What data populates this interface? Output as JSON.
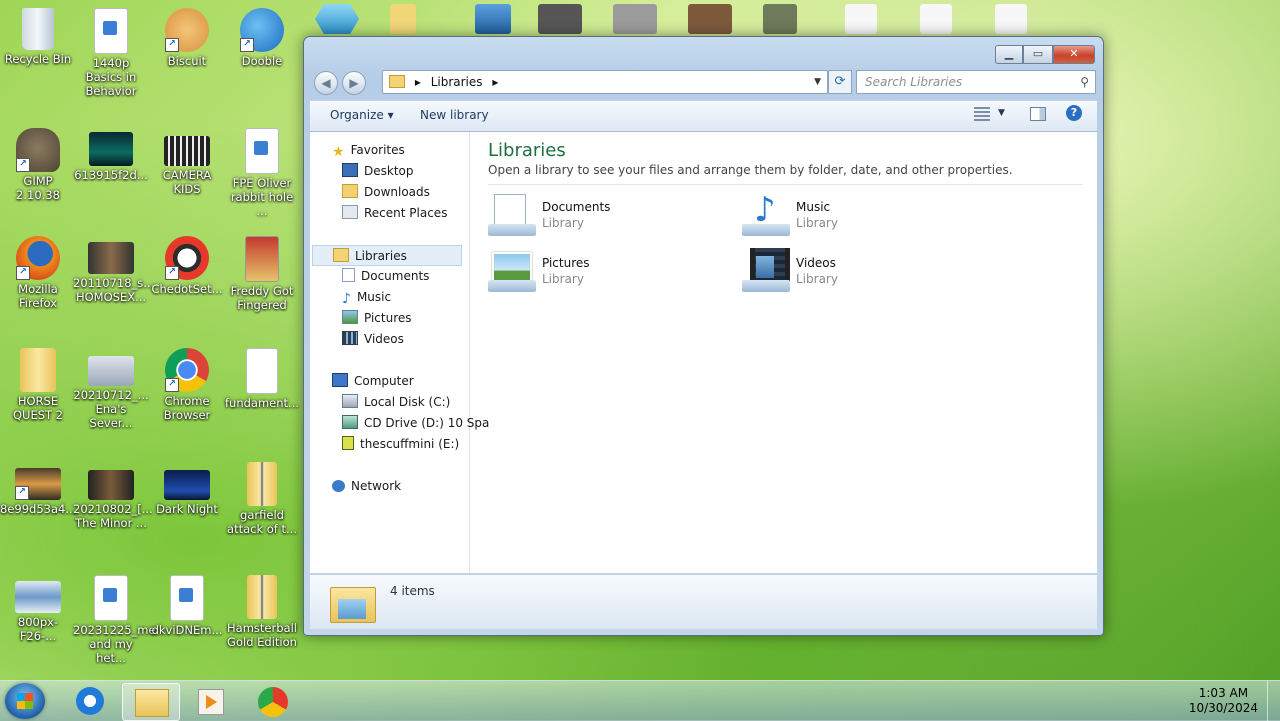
{
  "desktop": {
    "icons": [
      {
        "label": "Recycle Bin",
        "icon": "recycle-bin-icon"
      },
      {
        "label": "1440p Basics in Behavior",
        "icon": "audio-file-icon"
      },
      {
        "label": "Biscuit",
        "icon": "biscuit-icon"
      },
      {
        "label": "Dooble",
        "icon": "dooble-browser-icon"
      },
      {
        "label": "GIMP 2.10.38",
        "icon": "gimp-icon"
      },
      {
        "label": "613915f2d...",
        "icon": "image-file-icon"
      },
      {
        "label": "CAMERA KIDS",
        "icon": "video-file-icon"
      },
      {
        "label": "FPE Oliver rabbit hole ...",
        "icon": "audio-file-icon"
      },
      {
        "label": "Mozilla Firefox",
        "icon": "firefox-icon"
      },
      {
        "label": "20110718_s... HOMOSEX...",
        "icon": "video-file-icon"
      },
      {
        "label": "ChedotSet...",
        "icon": "chedot-icon"
      },
      {
        "label": "Freddy Got Fingered",
        "icon": "video-file-icon"
      },
      {
        "label": "HORSE QUEST 2",
        "icon": "folder-icon"
      },
      {
        "label": "20210712_... Ena's Sever...",
        "icon": "video-file-icon"
      },
      {
        "label": "Chrome Browser",
        "icon": "chrome-icon"
      },
      {
        "label": "fundament...",
        "icon": "document-file-icon"
      },
      {
        "label": "8e99d53a4...",
        "icon": "image-file-icon"
      },
      {
        "label": "20210802_[... The Minor ...",
        "icon": "video-file-icon"
      },
      {
        "label": "Dark Night",
        "icon": "image-file-icon"
      },
      {
        "label": "garfield attack of t...",
        "icon": "zip-folder-icon"
      },
      {
        "label": "800px-F26-...",
        "icon": "image-file-icon"
      },
      {
        "label": "20231225_me and my het...",
        "icon": "audio-file-icon"
      },
      {
        "label": "dkviDNEm...",
        "icon": "audio-file-icon"
      },
      {
        "label": "Hamsterball Gold Edition",
        "icon": "zip-folder-icon"
      }
    ]
  },
  "window": {
    "buttons": {
      "minimize": "▁",
      "maximize": "▭",
      "close": "✕"
    },
    "back_glyph": "◀",
    "forward_glyph": "▶",
    "address": {
      "path": "Libraries",
      "sep": "▸"
    },
    "refresh_glyph": "⟳",
    "search": {
      "placeholder": "Search Libraries",
      "icon_glyph": "⚲"
    },
    "toolbar": {
      "organize": "Organize ▾",
      "new_library": "New library",
      "help": "?"
    },
    "nav": {
      "favorites": "Favorites",
      "desktop": "Desktop",
      "downloads": "Downloads",
      "recent": "Recent Places",
      "libraries": "Libraries",
      "documents": "Documents",
      "music": "Music",
      "pictures": "Pictures",
      "videos": "Videos",
      "computer": "Computer",
      "local_disk": "Local Disk (C:)",
      "cd_drive": "CD Drive (D:) 10 Spa",
      "usb": "thescuffmini (E:)",
      "network": "Network"
    },
    "main": {
      "title": "Libraries",
      "subtitle": "Open a library to see your files and arrange them by folder, date, and other properties.",
      "libraries": [
        {
          "name": "Documents",
          "type": "Library"
        },
        {
          "name": "Music",
          "type": "Library"
        },
        {
          "name": "Pictures",
          "type": "Library"
        },
        {
          "name": "Videos",
          "type": "Library"
        }
      ]
    },
    "status": {
      "count": "4 items"
    }
  },
  "taskbar": {
    "clock_time": "1:03 AM",
    "clock_date": "10/30/2024"
  },
  "colors": {
    "accent": "#1f6f3f",
    "selection": "#e3eef9"
  }
}
